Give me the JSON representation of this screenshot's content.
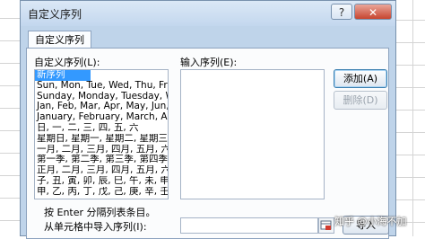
{
  "window": {
    "title": "自定义序列",
    "help_label": "?",
    "close_label": "✕"
  },
  "tabs": [
    {
      "label": "自定义序列"
    }
  ],
  "custom_list": {
    "label": "自定义序列(L):",
    "items": [
      "新序列",
      "Sun, Mon, Tue, Wed, Thu, Fri, Sat",
      "Sunday, Monday, Tuesday, Wednesday",
      "Jan, Feb, Mar, Apr, May, Jun, Jul",
      "January, February, March, April",
      "日, 一, 二, 三, 四, 五, 六",
      "星期日, 星期一, 星期二, 星期三, 星",
      "一月, 二月, 三月, 四月, 五月, 六月",
      "第一季, 第二季, 第三季, 第四季",
      "正月, 二月, 三月, 四月, 五月, 六月",
      "子, 丑, 寅, 卯, 辰, 巳, 午, 未, 申, 酉",
      "甲, 乙, 丙, 丁, 戊, 己, 庚, 辛, 壬, 癸"
    ],
    "selected_index": 0
  },
  "entries": {
    "label": "输入序列(E):",
    "value": ""
  },
  "buttons": {
    "add_label": "添加(A)",
    "delete_label": "删除(D)",
    "import_label": "导入"
  },
  "hint": "按 Enter 分隔列表条目。",
  "import_range": {
    "label": "从单元格中导入序列(I):",
    "value": ""
  },
  "watermark": "知乎 @小海不加"
}
